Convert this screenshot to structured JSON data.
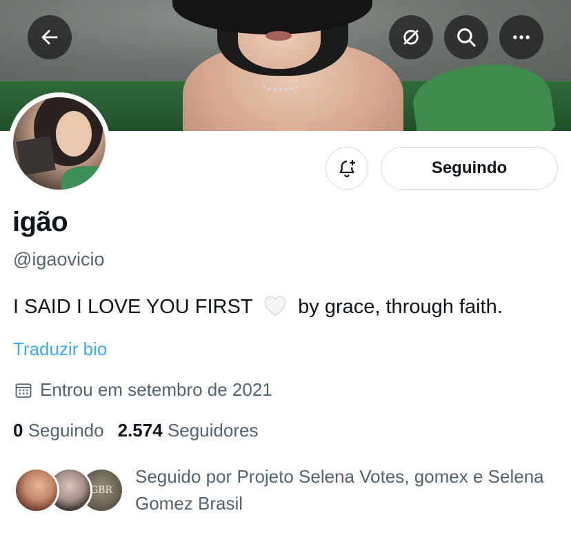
{
  "header": {
    "back_icon": "arrow-left-icon",
    "actions": [
      "hide-icon",
      "search-icon",
      "more-icon"
    ]
  },
  "profile": {
    "display_name": "igão",
    "handle": "@igaovicio",
    "bio_before": "I SAID I LOVE YOU FIRST",
    "bio_emoji": "🤍",
    "bio_after": "by grace, through faith.",
    "translate_label": "Traduzir bio",
    "joined": "Entrou em setembro de 2021",
    "following_count": "0",
    "following_label": "Seguindo",
    "followers_count": "2.574",
    "followers_label": "Seguidores",
    "followed_by": "Seguido por Projeto Selena Votes, gomex e Selena Gomez Brasil",
    "follower_avatar_3_text": "GBR"
  },
  "actions": {
    "notify_icon": "bell-plus-icon",
    "following_button": "Seguindo"
  },
  "colors": {
    "link": "#1d9bf0",
    "secondary_text": "#536471",
    "border": "#cfd9de"
  }
}
